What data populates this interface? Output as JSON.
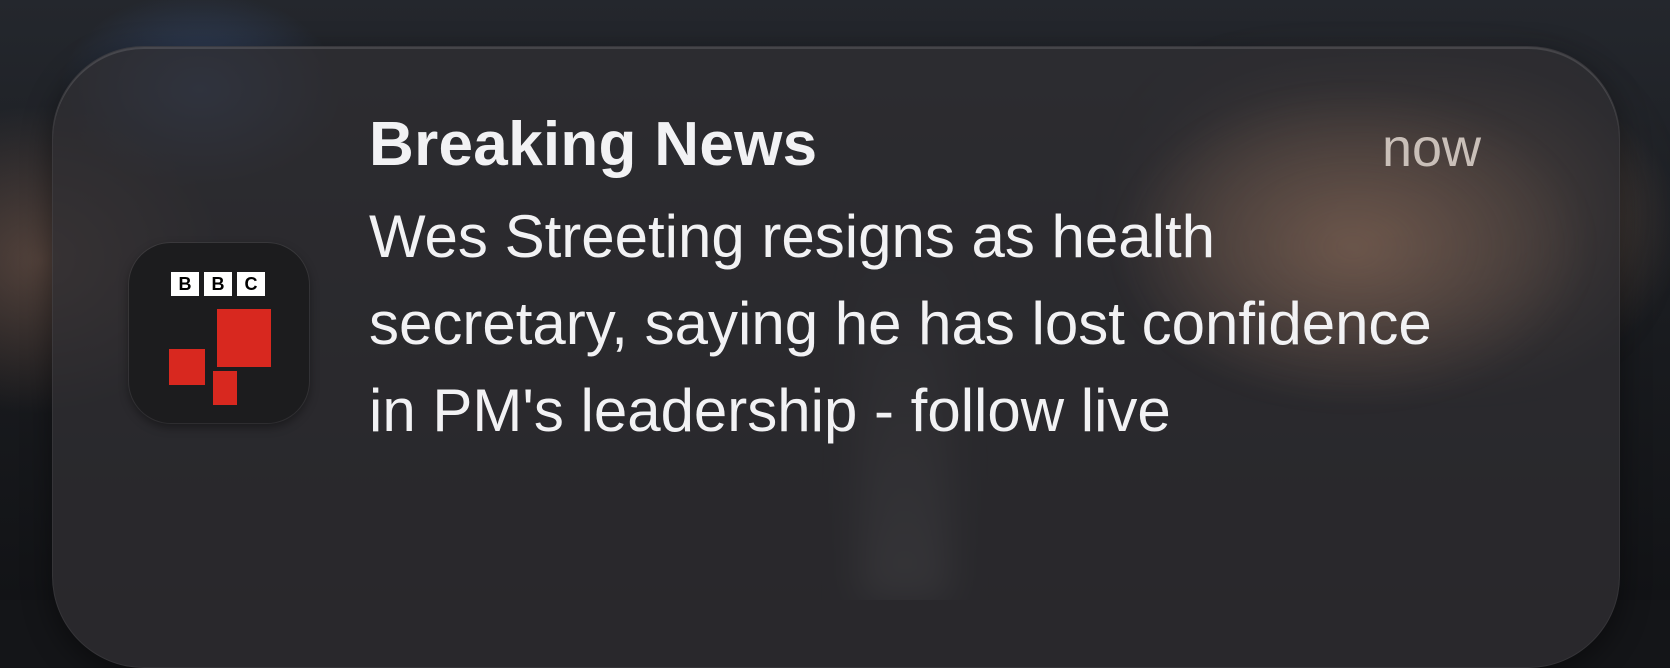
{
  "notification": {
    "app": {
      "name": "BBC",
      "logo_letters": [
        "B",
        "B",
        "C"
      ],
      "icon_name": "bbc-news-app-icon",
      "accent_color": "#d8281f"
    },
    "title": "Breaking News",
    "time": "now",
    "body": "Wes Streeting resigns as health secretary, saying he has lost confidence in PM's leadership - follow live"
  }
}
